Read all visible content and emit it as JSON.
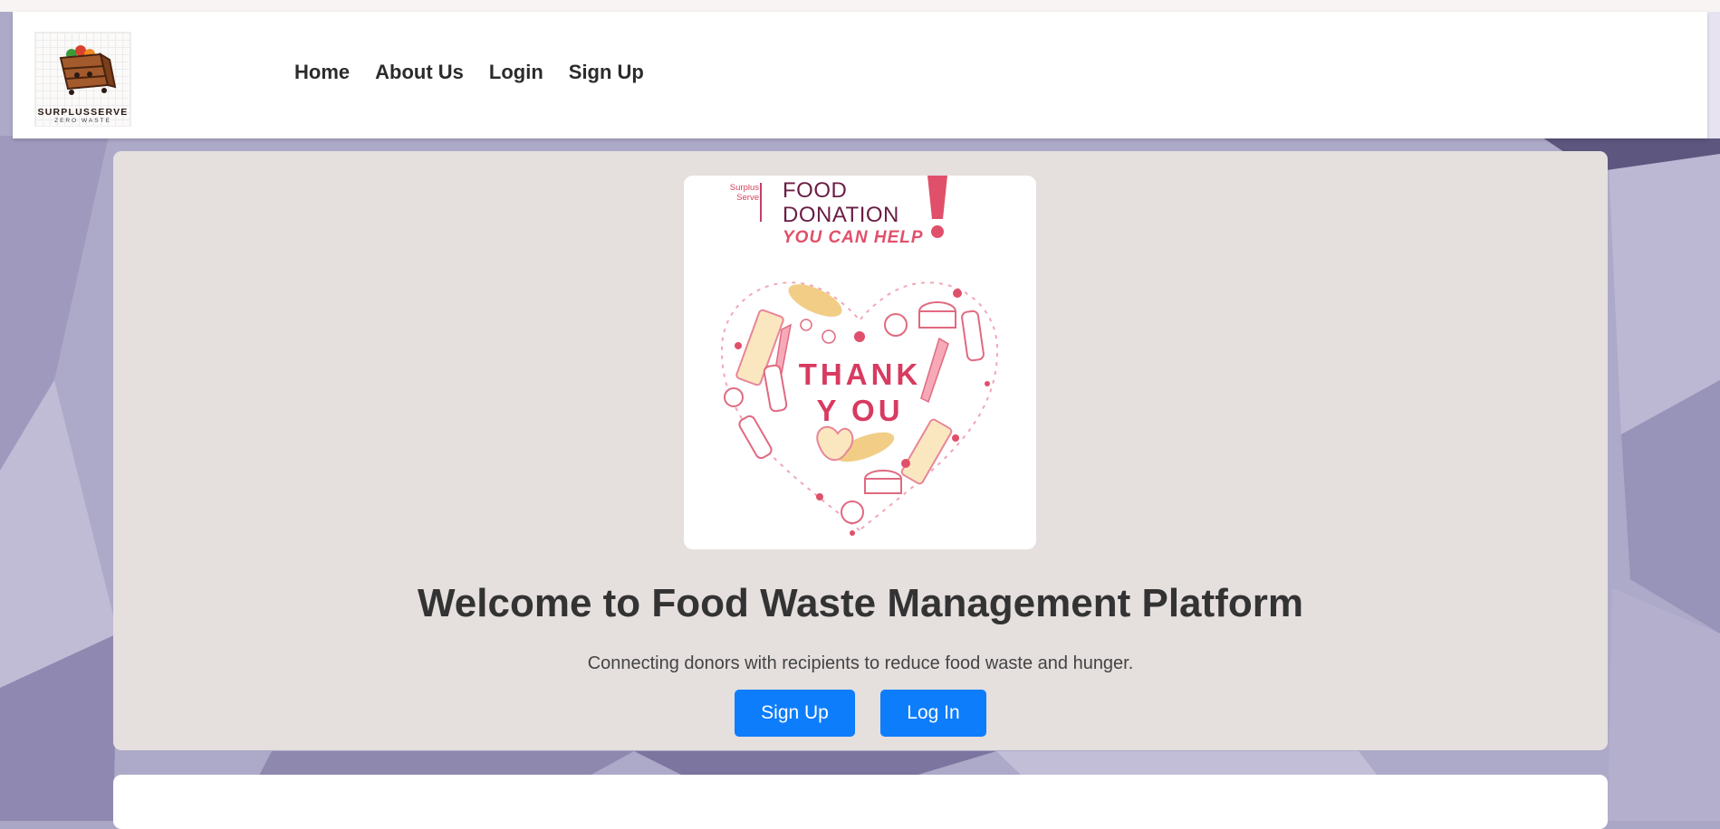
{
  "brand": {
    "name": "SURPLUSSERVE",
    "tagline": "ZERO WASTE"
  },
  "nav": {
    "items": [
      "Home",
      "About Us",
      "Login",
      "Sign Up"
    ]
  },
  "poster": {
    "brand_line1": "Surplus",
    "brand_line2": "Serve",
    "title_line1": "FOOD",
    "title_line2": "DONATION",
    "subtitle": "YOU CAN HELP",
    "center_line1": "THANK",
    "center_line2": "Y OU"
  },
  "hero": {
    "title": "Welcome to Food Waste Management Platform",
    "subtitle": "Connecting donors with recipients to reduce food waste and hunger.",
    "signup_label": "Sign Up",
    "login_label": "Log In"
  },
  "colors": {
    "primary_button": "#0d7dfc",
    "hero_background": "#e5dfde",
    "page_background": "#aaa6c6",
    "poster_accent": "#d83a60"
  }
}
